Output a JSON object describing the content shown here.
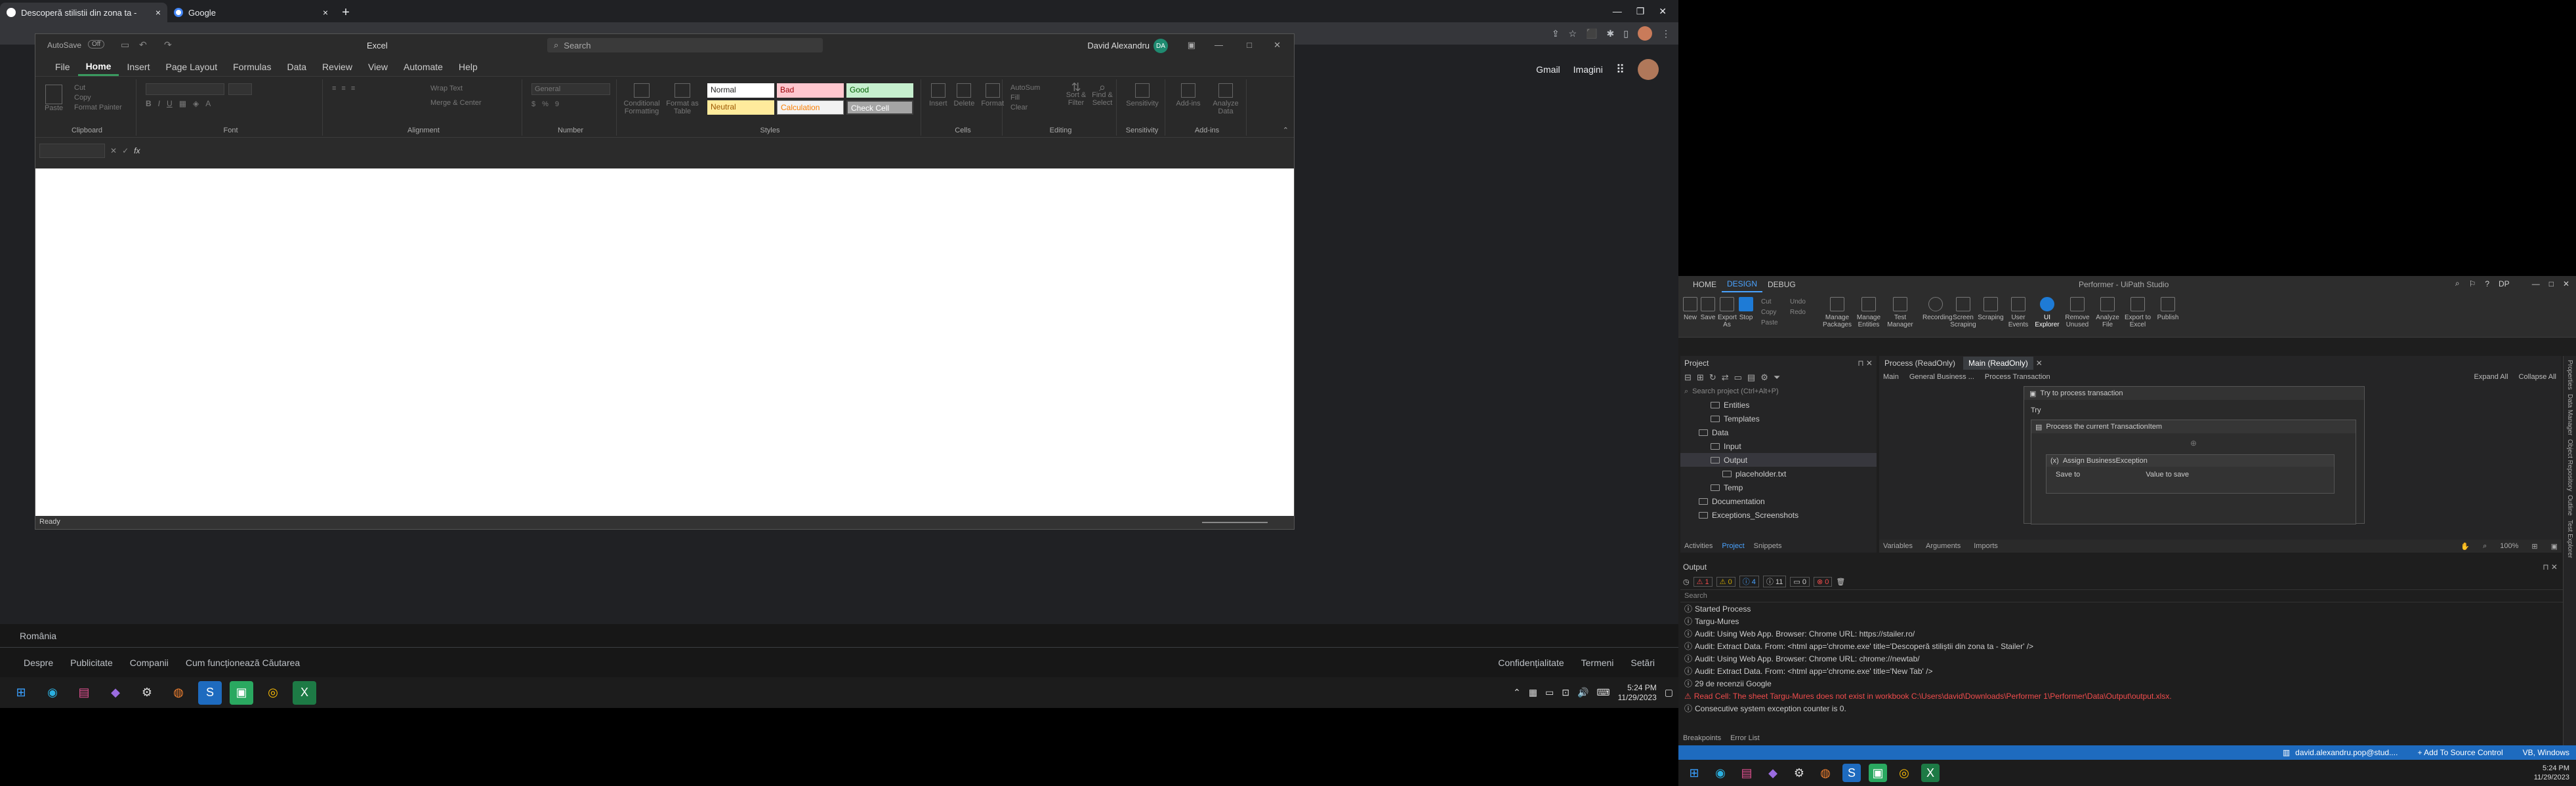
{
  "left_screen": {
    "chrome": {
      "tabs": [
        {
          "title": "Descoperă stilistii din zona ta - ",
          "favicon_color": "#ffffff"
        },
        {
          "title": "Google",
          "favicon_color": "#4285f4"
        }
      ],
      "new_tab": "+",
      "toolbar_right": {
        "gmail": "Gmail",
        "images": "Imagini"
      }
    },
    "excel": {
      "title": "Excel",
      "autosave": "AutoSave",
      "autosave_state": "Off",
      "search_placeholder": "Search",
      "user": "David Alexandru",
      "user_initials": "DA",
      "menu": [
        "File",
        "Home",
        "Insert",
        "Page Layout",
        "Formulas",
        "Data",
        "Review",
        "View",
        "Automate",
        "Help"
      ],
      "selected_menu": "Home",
      "ribbon_groups": {
        "clipboard": "Clipboard",
        "font": "Font",
        "alignment": "Alignment",
        "number": "Number",
        "styles": "Styles",
        "cells": "Cells",
        "editing": "Editing",
        "sensitivity": "Sensitivity",
        "addins": "Add-ins"
      },
      "ribbon_buttons": {
        "paste": "Paste",
        "cut": "Cut",
        "copy": "Copy",
        "format_painter": "Format Painter",
        "wrap_text": "Wrap Text",
        "merge_center": "Merge & Center",
        "number_format": "General",
        "conditional": "Conditional Formatting",
        "format_as_table": "Format as Table",
        "insert": "Insert",
        "delete": "Delete",
        "format": "Format",
        "autosum": "AutoSum",
        "fill": "Fill",
        "clear": "Clear",
        "sort_filter": "Sort & Filter",
        "find_select": "Find & Select",
        "sensitivity_btn": "Sensitivity",
        "addins_btn": "Add-ins",
        "analyze": "Analyze Data"
      },
      "styles": {
        "normal": "Normal",
        "bad": "Bad",
        "good": "Good",
        "neutral": "Neutral",
        "calculation": "Calculation",
        "check_cell": "Check Cell"
      },
      "fx": "fx",
      "status": "Ready"
    },
    "google_footer": {
      "country": "România",
      "links_left": [
        "Despre",
        "Publicitate",
        "Companii",
        "Cum funcționează Căutarea"
      ],
      "links_right": [
        "Confidențialitate",
        "Termeni",
        "Setări"
      ]
    },
    "taskbar": {
      "time": "5:24 PM",
      "date": "11/29/2023"
    }
  },
  "right_screen": {
    "studio": {
      "title": "Performer - UiPath Studio",
      "tabs": [
        "HOME",
        "DESIGN",
        "DEBUG"
      ],
      "active_tab": "DESIGN",
      "user_initials": "DP",
      "toolbar": {
        "new": "New",
        "save": "Save",
        "export": "Export As",
        "stop": "Stop",
        "cut": "Cut",
        "copy": "Copy",
        "paste": "Paste",
        "undo": "Undo",
        "redo": "Redo",
        "manage_packages": "Manage Packages",
        "manage_entities": "Manage Entities",
        "test_manager": "Test Manager",
        "recording": "Recording",
        "screen_scraping": "Screen Scraping",
        "data_scraping": "Scraping",
        "user_events": "User Events",
        "ui_explorer": "UI Explorer",
        "remove_unused": "Remove Unused",
        "analyze_file": "Analyze File",
        "export_excel": "Export to Excel",
        "publish": "Publish"
      },
      "project_panel": {
        "title": "Project",
        "search_placeholder": "Search project (Ctrl+Alt+P)",
        "tree": [
          {
            "label": "Entities",
            "indent": 2,
            "type": "item"
          },
          {
            "label": "Templates",
            "indent": 2,
            "type": "folder"
          },
          {
            "label": "Data",
            "indent": 1,
            "type": "folder"
          },
          {
            "label": "Input",
            "indent": 2,
            "type": "folder"
          },
          {
            "label": "Output",
            "indent": 2,
            "type": "folder"
          },
          {
            "label": "placeholder.txt",
            "indent": 3,
            "type": "file"
          },
          {
            "label": "Temp",
            "indent": 2,
            "type": "folder"
          },
          {
            "label": "Documentation",
            "indent": 1,
            "type": "folder"
          },
          {
            "label": "Exceptions_Screenshots",
            "indent": 1,
            "type": "folder"
          }
        ],
        "bottom_tabs": [
          "Activities",
          "Project",
          "Snippets"
        ]
      },
      "designer": {
        "doc_tabs": [
          "Process (ReadOnly)",
          "Main (ReadOnly)"
        ],
        "breadcrumb": [
          "Main",
          "General Business ...",
          "Process Transaction"
        ],
        "expand_all": "Expand All",
        "collapse_all": "Collapse All",
        "activity_title": "Try to process transaction",
        "try_label": "Try",
        "inner_title": "Process the current TransactionItem",
        "assign_title": "Assign BusinessException",
        "save_to": "Save to",
        "value_to_save": "Value to save",
        "bottom_tabs": [
          "Variables",
          "Arguments",
          "Imports"
        ],
        "zoom": "100%"
      },
      "output": {
        "title": "Output",
        "counts": [
          "1",
          "0",
          "4",
          "11",
          "0",
          "0"
        ],
        "search_placeholder": "Search",
        "lines": [
          {
            "text": "Started Process",
            "err": false
          },
          {
            "text": "Targu-Mures",
            "err": false
          },
          {
            "text": "Audit: Using Web App. Browser: Chrome URL: https://stailer.ro/",
            "err": false
          },
          {
            "text": "Audit: Extract Data. From: <html app='chrome.exe' title='Descoperă stiliștii din zona ta - Stailer' />",
            "err": false
          },
          {
            "text": "Audit: Using Web App. Browser: Chrome URL: chrome://newtab/",
            "err": false
          },
          {
            "text": "Audit: Extract Data. From: <html app='chrome.exe' title='New Tab' />",
            "err": false
          },
          {
            "text": "29 de recenzii Google",
            "err": false
          },
          {
            "text": "Read Cell: The sheet Targu-Mures does not exist in workbook C:\\Users\\david\\Downloads\\Performer 1\\Performer\\Data\\Output\\output.xlsx.",
            "err": true
          },
          {
            "text": "Consecutive system exception counter is 0.",
            "err": false
          }
        ],
        "bottom_tabs": [
          "Breakpoints",
          "Error List"
        ]
      },
      "right_strip": [
        "Properties",
        "Data Manager",
        "Object Repository",
        "Outline",
        "Test Explorer"
      ],
      "status_bar": {
        "user": "david.alexandru.pop@stud....",
        "source_control": "+ Add To Source Control",
        "target": "VB, Windows"
      }
    },
    "taskbar": {
      "time": "5:24 PM",
      "date": "11/29/2023"
    }
  }
}
